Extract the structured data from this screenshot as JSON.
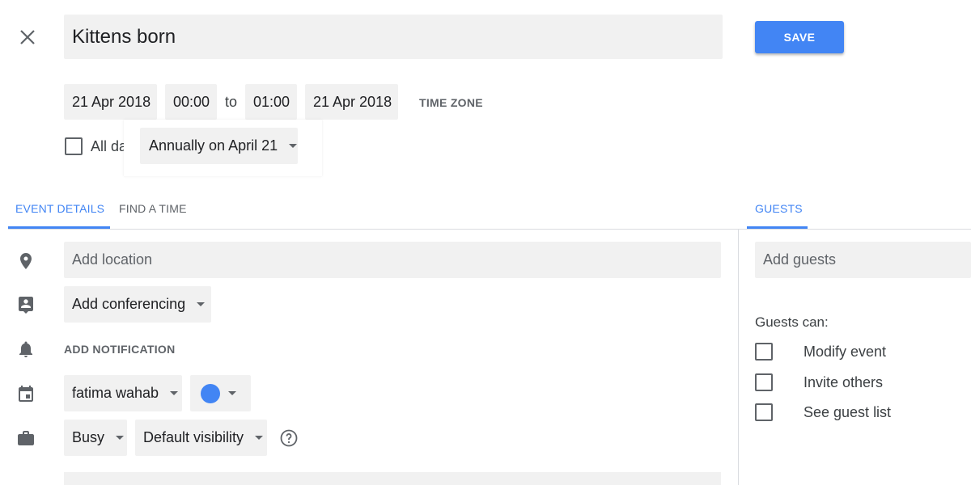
{
  "header": {
    "close_icon": "close-icon",
    "title": "Kittens born",
    "save_label": "SAVE",
    "accent": "#4285f4"
  },
  "datetime": {
    "start_date": "21 Apr 2018",
    "start_time": "00:00",
    "to_label": "to",
    "end_time": "01:00",
    "end_date": "21 Apr 2018",
    "time_zone_label": "TIME ZONE",
    "all_day_label": "All da",
    "all_day_checked": false,
    "recurrence": "Annually on April 21"
  },
  "tabs": {
    "event_details": "EVENT DETAILS",
    "find_a_time": "FIND A TIME",
    "guests": "GUESTS",
    "active": "EVENT DETAILS"
  },
  "details": {
    "location_placeholder": "Add location",
    "conferencing_label": "Add conferencing",
    "notification_label": "ADD NOTIFICATION",
    "calendar_owner": "fatima wahab",
    "event_color": "#4285f4",
    "busy_label": "Busy",
    "visibility_label": "Default visibility",
    "icons": [
      "location-pin-icon",
      "conferencing-icon",
      "bell-icon",
      "calendar-icon",
      "briefcase-icon",
      "help-icon"
    ]
  },
  "guests": {
    "add_placeholder": "Add guests",
    "guests_can_label": "Guests can:",
    "permissions": [
      {
        "label": "Modify event",
        "checked": false
      },
      {
        "label": "Invite others",
        "checked": false
      },
      {
        "label": "See guest list",
        "checked": false
      }
    ]
  }
}
